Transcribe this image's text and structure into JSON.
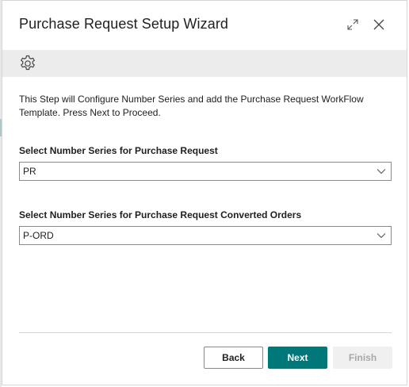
{
  "dialog": {
    "title": "Purchase Request Setup Wizard",
    "icons": {
      "expand": "expand-icon",
      "close": "close-icon",
      "settings": "gear-icon"
    }
  },
  "content": {
    "intro": "This Step will Configure Number Series and add the Purchase Request WorkFlow Template. Press Next to Proceed.",
    "fields": [
      {
        "label": "Select Number Series for Purchase Request",
        "value": "PR"
      },
      {
        "label": "Select Number Series for Purchase Request Converted Orders",
        "value": "P-ORD"
      }
    ]
  },
  "footer": {
    "back_label": "Back",
    "next_label": "Next",
    "finish_label": "Finish"
  },
  "colors": {
    "accent": "#00787a",
    "action_bar": "#ececec",
    "disabled_bg": "#f0f0f0",
    "disabled_text": "#a8a8a8"
  }
}
